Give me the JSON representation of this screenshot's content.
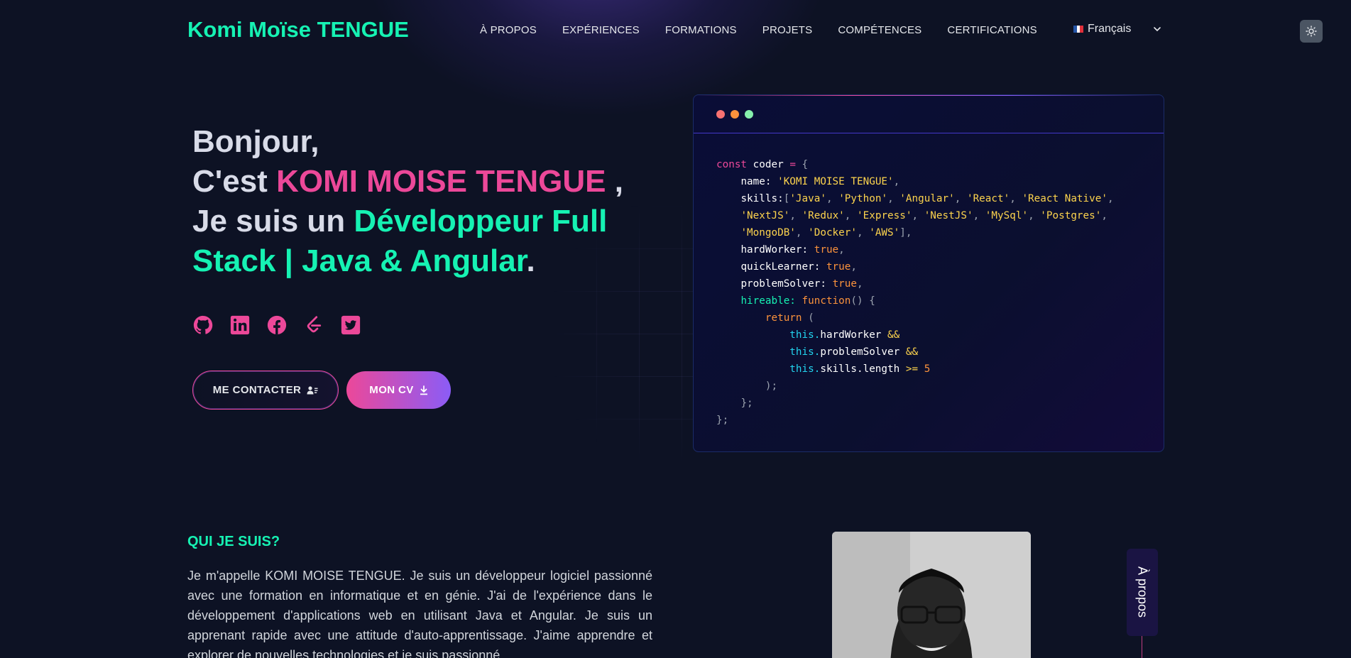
{
  "nav": {
    "logo": "Komi Moïse TENGUE",
    "items": [
      "À PROPOS",
      "EXPÉRIENCES",
      "FORMATIONS",
      "PROJETS",
      "COMPÉTENCES",
      "CERTIFICATIONS"
    ],
    "language": "Français"
  },
  "hero": {
    "line1": "Bonjour,",
    "cest": "C'est ",
    "name": "KOMI MOISE TENGUE",
    "je": " , Je suis un ",
    "role": "Développeur Full Stack | Java & Angular",
    "period": ".",
    "contact_button": "ME CONTACTER",
    "cv_button": "MON CV"
  },
  "socials": [
    "github-icon",
    "linkedin-icon",
    "facebook-icon",
    "leetcode-icon",
    "twitter-icon"
  ],
  "code": {
    "kw_const": "const",
    "var_name": "coder",
    "name_key": "name",
    "name_value": "'KOMI MOISE TENGUE'",
    "skills_key": "skills",
    "skills": [
      "'Java'",
      "'Python'",
      "'Angular'",
      "'React'",
      "'React Native'",
      "'NextJS'",
      "'Redux'",
      "'Express'",
      "'NestJS'",
      "'MySql'",
      "'Postgres'",
      "'MongoDB'",
      "'Docker'",
      "'AWS'"
    ],
    "hardWorker_key": "hardWorker",
    "quickLearner_key": "quickLearner",
    "problemSolver_key": "problemSolver",
    "true_value": "true",
    "hireable_key": "hireable:",
    "function_kw": "function",
    "return_kw": "return",
    "this_kw": "this.",
    "skills_length": "skills.length",
    "op_and": "&&",
    "op_gte": ">=",
    "num_five": "5"
  },
  "about": {
    "title": "QUI JE SUIS?",
    "text": "Je m'appelle KOMI MOISE TENGUE. Je suis un développeur logiciel passionné avec une formation en informatique et en génie. J'ai de l'expérience dans le développement d'applications web en utilisant Java et Angular. Je suis un apprenant rapide avec une attitude d'auto-apprentissage. J'aime apprendre et explorer de nouvelles technologies et je suis passionné",
    "side_tab": "À propos"
  },
  "colors": {
    "background": "#0d1224",
    "accent_green": "#16f2b3",
    "accent_pink": "#ec4899",
    "accent_violet": "#8b5cf6"
  }
}
